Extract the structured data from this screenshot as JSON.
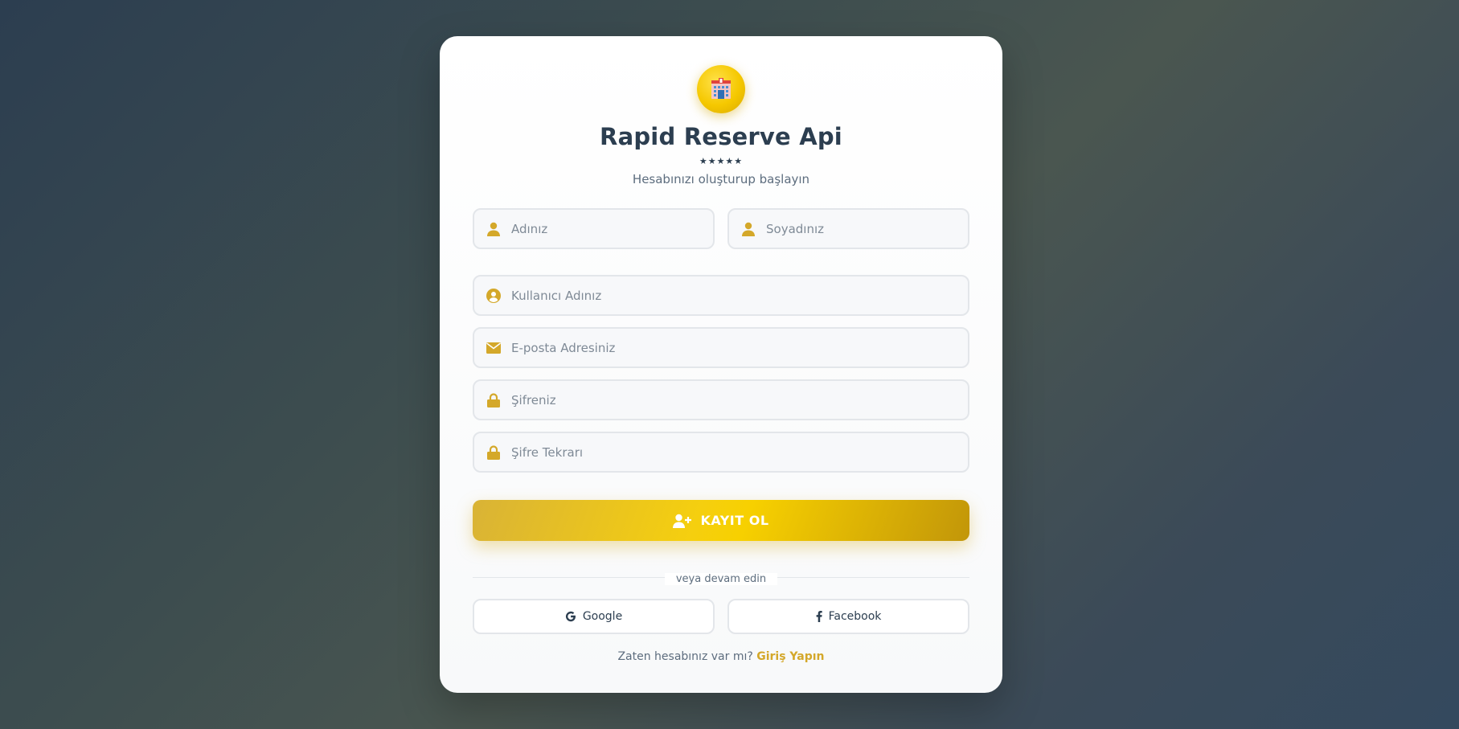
{
  "app": {
    "title": "Rapid Reserve Api",
    "stars": "★★★★★",
    "subtitle": "Hesabınızı oluşturup başlayın",
    "logo_icon": "hotel-emoji"
  },
  "form": {
    "first_name": {
      "placeholder": "Adınız",
      "value": "",
      "icon": "user-icon"
    },
    "last_name": {
      "placeholder": "Soyadınız",
      "value": "",
      "icon": "user-icon"
    },
    "username": {
      "placeholder": "Kullanıcı Adınız",
      "value": "",
      "icon": "user-circle-icon"
    },
    "email": {
      "placeholder": "E-posta Adresiniz",
      "value": "",
      "icon": "envelope-icon"
    },
    "password": {
      "placeholder": "Şifreniz",
      "value": "",
      "icon": "lock-icon"
    },
    "password_confirm": {
      "placeholder": "Şifre Tekrarı",
      "value": "",
      "icon": "lock-icon"
    },
    "submit_label": "KAYIT OL"
  },
  "social": {
    "divider_text": "veya devam edin",
    "google_label": "Google",
    "facebook_label": "Facebook"
  },
  "footer": {
    "prompt": "Zaten hesabınız var mı?",
    "login_link": "Giriş Yapın"
  },
  "colors": {
    "accent": "#d4a82a",
    "gold": "#f5cf0f",
    "text_dark": "#2c3e50",
    "text_muted": "#5d6d7e"
  }
}
